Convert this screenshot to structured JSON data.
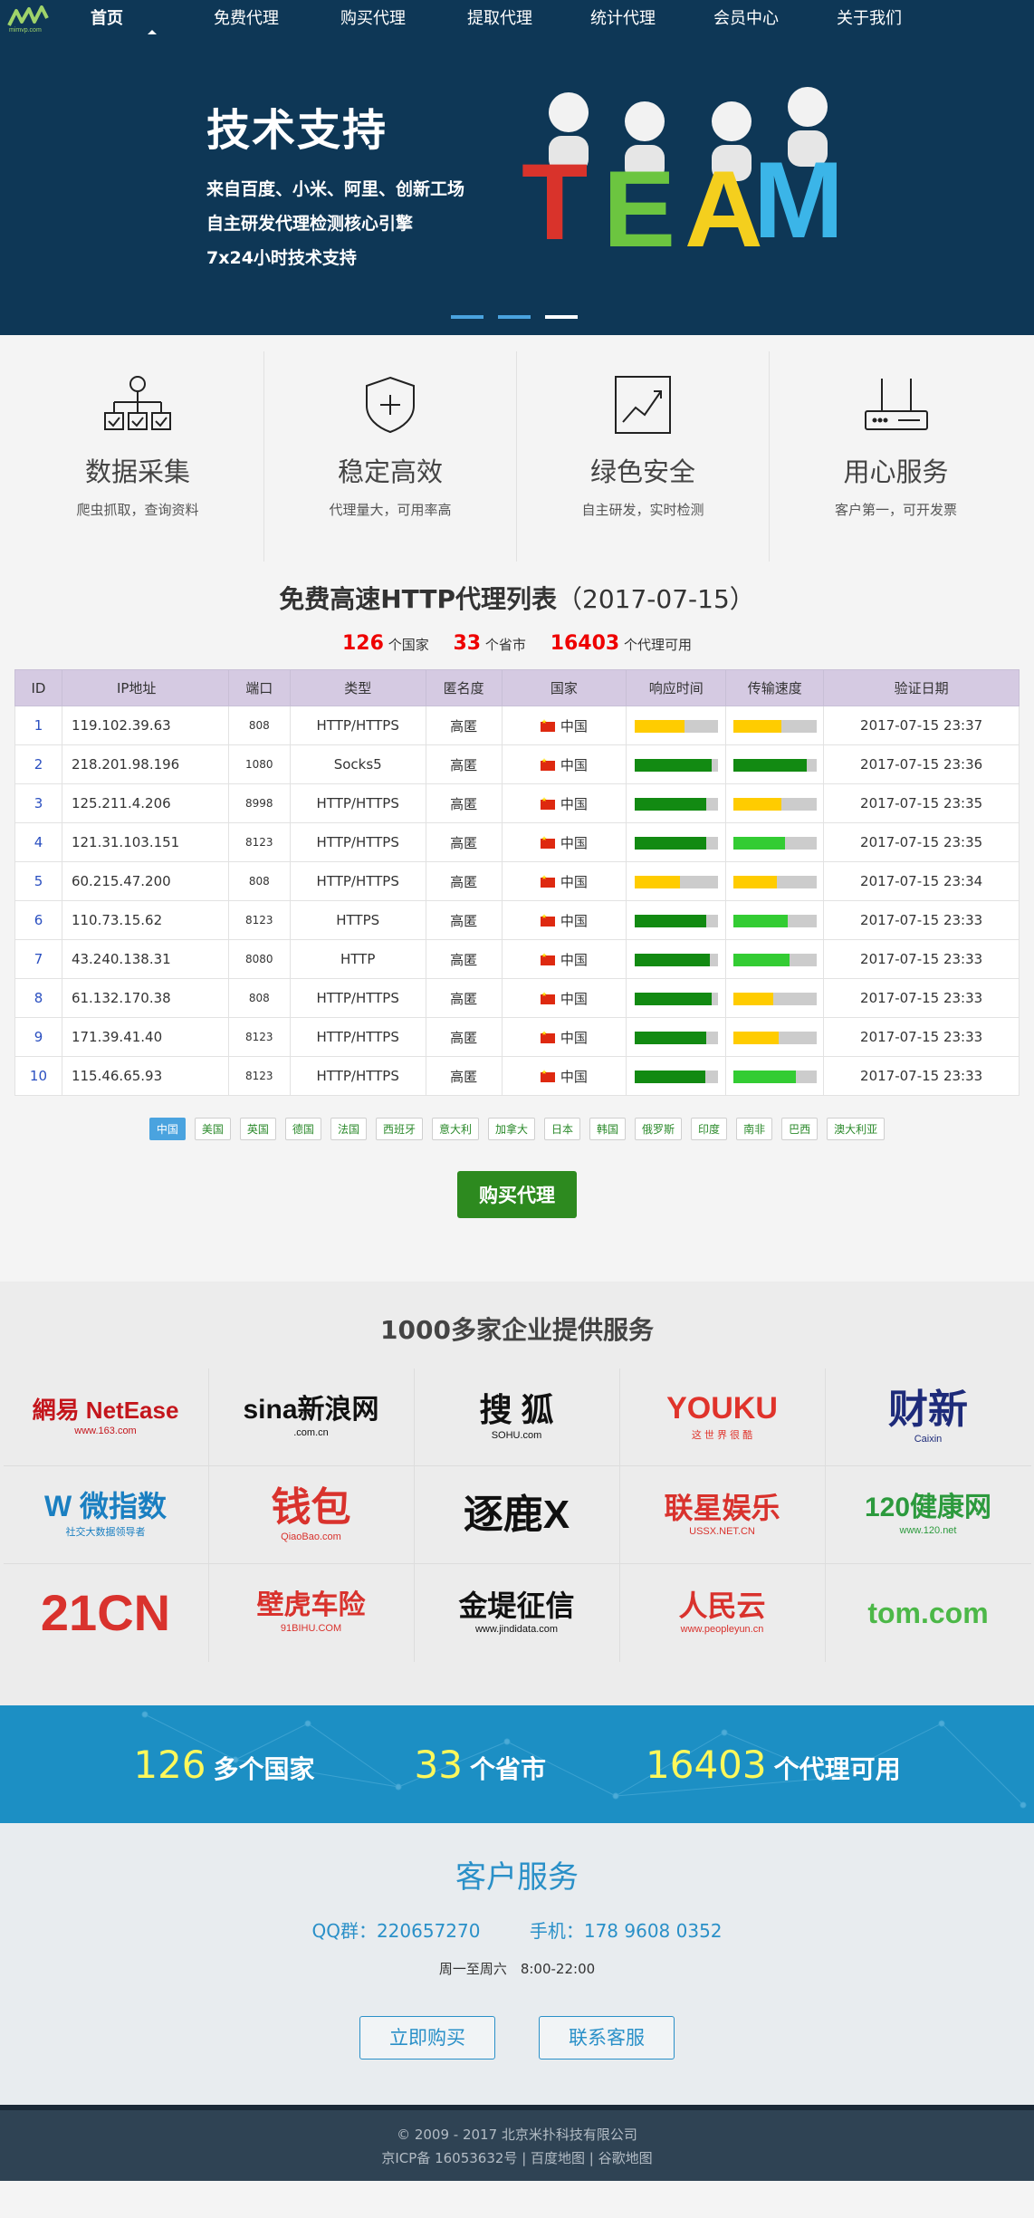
{
  "logo": {
    "text": "mimvp.com"
  },
  "nav": [
    "首页",
    "免费代理",
    "购买代理",
    "提取代理",
    "统计代理",
    "会员中心",
    "关于我们"
  ],
  "hero": {
    "title": "技术支持",
    "lines": [
      "来自百度、小米、阿里、创新工场",
      "自主研发代理检测核心引擎",
      "7x24小时技术支持"
    ],
    "art_letters": [
      "T",
      "E",
      "A",
      "M"
    ]
  },
  "features": [
    {
      "title": "数据采集",
      "desc": "爬虫抓取，查询资料",
      "icon": "hierarchy-icon"
    },
    {
      "title": "稳定高效",
      "desc": "代理量大，可用率高",
      "icon": "shield-plus-icon"
    },
    {
      "title": "绿色安全",
      "desc": "自主研发，实时检测",
      "icon": "line-chart-icon"
    },
    {
      "title": "用心服务",
      "desc": "客户第一，可开发票",
      "icon": "router-icon"
    }
  ],
  "proxy_list": {
    "title": "免费高速HTTP代理列表",
    "date": "（2017-07-15）",
    "stats": [
      {
        "num": "126",
        "label": "个国家"
      },
      {
        "num": "33",
        "label": "个省市"
      },
      {
        "num": "16403",
        "label": "个代理可用"
      }
    ],
    "headers": [
      "ID",
      "IP地址",
      "端口",
      "类型",
      "匿名度",
      "国家",
      "响应时间",
      "传输速度",
      "验证日期"
    ],
    "rows": [
      {
        "id": "1",
        "ip": "119.102.39.63",
        "port": "808",
        "type": "HTTP/HTTPS",
        "anon": "高匿",
        "country": "中国",
        "resp": 0.6,
        "resp_color": "#ffcc00",
        "speed": 0.58,
        "speed_color": "#ffcc00",
        "date": "2017-07-15 23:37"
      },
      {
        "id": "2",
        "ip": "218.201.98.196",
        "port": "1080",
        "type": "Socks5",
        "anon": "高匿",
        "country": "中国",
        "resp": 0.93,
        "resp_color": "#128a12",
        "speed": 0.88,
        "speed_color": "#128a12",
        "date": "2017-07-15 23:36"
      },
      {
        "id": "3",
        "ip": "125.211.4.206",
        "port": "8998",
        "type": "HTTP/HTTPS",
        "anon": "高匿",
        "country": "中国",
        "resp": 0.86,
        "resp_color": "#128a12",
        "speed": 0.58,
        "speed_color": "#ffcc00",
        "date": "2017-07-15 23:35"
      },
      {
        "id": "4",
        "ip": "121.31.103.151",
        "port": "8123",
        "type": "HTTP/HTTPS",
        "anon": "高匿",
        "country": "中国",
        "resp": 0.86,
        "resp_color": "#128a12",
        "speed": 0.62,
        "speed_color": "#33cc33",
        "date": "2017-07-15 23:35"
      },
      {
        "id": "5",
        "ip": "60.215.47.200",
        "port": "808",
        "type": "HTTP/HTTPS",
        "anon": "高匿",
        "country": "中国",
        "resp": 0.55,
        "resp_color": "#ffcc00",
        "speed": 0.52,
        "speed_color": "#ffcc00",
        "date": "2017-07-15 23:34"
      },
      {
        "id": "6",
        "ip": "110.73.15.62",
        "port": "8123",
        "type": "HTTPS",
        "anon": "高匿",
        "country": "中国",
        "resp": 0.86,
        "resp_color": "#128a12",
        "speed": 0.65,
        "speed_color": "#33cc33",
        "date": "2017-07-15 23:33"
      },
      {
        "id": "7",
        "ip": "43.240.138.31",
        "port": "8080",
        "type": "HTTP",
        "anon": "高匿",
        "country": "中国",
        "resp": 0.9,
        "resp_color": "#128a12",
        "speed": 0.68,
        "speed_color": "#33cc33",
        "date": "2017-07-15 23:33"
      },
      {
        "id": "8",
        "ip": "61.132.170.38",
        "port": "808",
        "type": "HTTP/HTTPS",
        "anon": "高匿",
        "country": "中国",
        "resp": 0.93,
        "resp_color": "#128a12",
        "speed": 0.48,
        "speed_color": "#ffcc00",
        "date": "2017-07-15 23:33"
      },
      {
        "id": "9",
        "ip": "171.39.41.40",
        "port": "8123",
        "type": "HTTP/HTTPS",
        "anon": "高匿",
        "country": "中国",
        "resp": 0.86,
        "resp_color": "#128a12",
        "speed": 0.55,
        "speed_color": "#ffcc00",
        "date": "2017-07-15 23:33"
      },
      {
        "id": "10",
        "ip": "115.46.65.93",
        "port": "8123",
        "type": "HTTP/HTTPS",
        "anon": "高匿",
        "country": "中国",
        "resp": 0.85,
        "resp_color": "#128a12",
        "speed": 0.75,
        "speed_color": "#33cc33",
        "date": "2017-07-15 23:33"
      }
    ]
  },
  "countries": [
    "中国",
    "美国",
    "英国",
    "德国",
    "法国",
    "西班牙",
    "意大利",
    "加拿大",
    "日本",
    "韩国",
    "俄罗斯",
    "印度",
    "南非",
    "巴西",
    "澳大利亚"
  ],
  "buy_button": "购买代理",
  "partners": {
    "title": "1000多家企业提供服务",
    "logos": [
      {
        "main": "網易 NetEase",
        "sub": "www.163.com",
        "color": "#c4161c"
      },
      {
        "main": "sina新浪网",
        "sub": ".com.cn",
        "color": "#111"
      },
      {
        "main": "搜 狐",
        "sub": "SOHU.com",
        "color": "#111"
      },
      {
        "main": "YOUKU",
        "sub": "这 世 界 很 酷",
        "color": "#e0332b"
      },
      {
        "main": "财新",
        "sub": "Caixin",
        "color": "#1e2b7a"
      },
      {
        "main": "W 微指数",
        "sub": "社交大数据领导者",
        "color": "#1a7fc1"
      },
      {
        "main": "钱包",
        "sub": "QiaoBao.com",
        "color": "#d9322d"
      },
      {
        "main": "逐鹿X",
        "sub": "",
        "color": "#111"
      },
      {
        "main": "联星娱乐",
        "sub": "USSX.NET.CN",
        "color": "#d9322d"
      },
      {
        "main": "120健康网",
        "sub": "www.120.net",
        "color": "#2c9a3d"
      },
      {
        "main": "21CN",
        "sub": "",
        "color": "#d9322d"
      },
      {
        "main": "壁虎车险",
        "sub": "91BIHU.COM",
        "color": "#d9322d"
      },
      {
        "main": "金堤征信",
        "sub": "www.jindidata.com",
        "color": "#111"
      },
      {
        "main": "人民云",
        "sub": "www.peopleyun.cn",
        "color": "#d9322d"
      },
      {
        "main": "tom.com",
        "sub": "",
        "color": "#4cb848"
      }
    ]
  },
  "banner_stats": [
    {
      "num": "126",
      "label": "多个国家"
    },
    {
      "num": "33",
      "label": "个省市"
    },
    {
      "num": "16403",
      "label": "个代理可用"
    }
  ],
  "service": {
    "title": "客户服务",
    "qq": "QQ群：220657270",
    "phone": "手机：178 9608 0352",
    "hours": "周一至周六　8:00-22:00",
    "buy_now": "立即购买",
    "contact": "联系客服"
  },
  "footer": {
    "copyright": "© 2009 - 2017 北京米扑科技有限公司",
    "icp": "京ICP备 16053632号 | 百度地图 | 谷歌地图"
  },
  "colors": {
    "hero_bg": "#0e3756",
    "table_header": "#d5cae2",
    "buy_green": "#2d8a1f",
    "banner_blue": "#1c8fc4",
    "service_blue": "#2a90c8",
    "footer_bg": "#2f4354"
  }
}
